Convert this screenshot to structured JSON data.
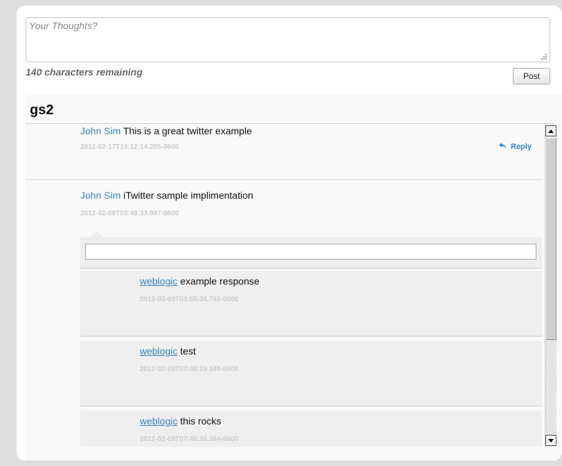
{
  "composer": {
    "placeholder": "Your Thoughts?",
    "remaining_text": "140 characters remaining",
    "post_label": "Post"
  },
  "feed": {
    "title": "gs2",
    "tweets": [
      {
        "author": "John Sim",
        "text": "This is a great twitter example",
        "timestamp": "2012-02-17T10:12:14.205-0600",
        "reply_label": "Reply"
      },
      {
        "author": "John Sim",
        "text": "iTwitter sample implimentation",
        "timestamp": "2012-02-09T03:49:33.897-0600",
        "reply_input_value": "",
        "responses": [
          {
            "author": "weblogic",
            "text": "example response",
            "timestamp": "2012-02-09T03:55:38.761-0600"
          },
          {
            "author": "weblogic",
            "text": "test",
            "timestamp": "2012-02-09T07:48:29.349-0600"
          },
          {
            "author": "weblogic",
            "text": "this rocks",
            "timestamp": "2012-02-09T07:48:36.364-0600"
          }
        ]
      }
    ]
  },
  "colors": {
    "link": "#3b82c4",
    "timestamp": "#c8c8c8",
    "page_background": "#dedede"
  },
  "icons": {
    "reply": "reply-arrow-icon",
    "scroll_up": "arrow-up-icon",
    "scroll_down": "arrow-down-icon",
    "resize": "resize-grip-icon"
  }
}
